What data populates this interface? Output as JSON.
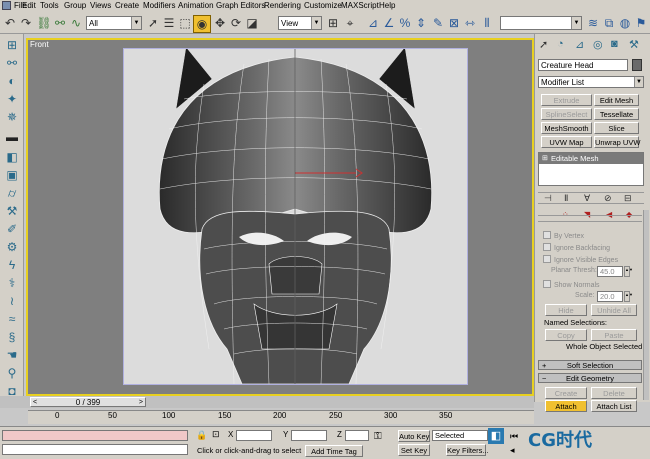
{
  "menu": [
    "File",
    "Edit",
    "Tools",
    "Group",
    "Views",
    "Create",
    "Modifiers",
    "Animation",
    "Graph Editors",
    "Rendering",
    "Customize",
    "MAXScript",
    "Help"
  ],
  "toolbar": {
    "selection_filter": "All",
    "reference_coord": "View",
    "undo_icon": "undo-icon",
    "redo_icon": "redo-icon"
  },
  "viewport": {
    "label": "Front"
  },
  "command_panel": {
    "object_name": "Creature Head",
    "modifier_list": "Modifier List",
    "modifier_buttons": [
      "Extrude",
      "Edit Mesh",
      "SplineSelect",
      "Tessellate",
      "MeshSmooth",
      "Slice",
      "UVW Map",
      "Unwrap UVW"
    ],
    "stack_item": "Editable Mesh",
    "selection": {
      "by_vertex": "By Vertex",
      "ignore_backfacing": "Ignore Backfacing",
      "ignore_visible_edges": "Ignore Visible Edges",
      "planar_thresh_label": "Planar Thresh:",
      "planar_thresh_value": "45.0",
      "show_normals": "Show Normals",
      "scale_label": "Scale:",
      "scale_value": "20.0",
      "hide": "Hide",
      "unhide_all": "Unhide All",
      "named_selections": "Named Selections:",
      "copy": "Copy",
      "paste": "Paste",
      "whole_object": "Whole Object Selected"
    },
    "rollouts": {
      "soft_selection": "Soft Selection",
      "edit_geometry": "Edit Geometry"
    },
    "edit_geometry": {
      "create": "Create",
      "delete": "Delete",
      "attach": "Attach",
      "attach_list": "Attach List"
    }
  },
  "timeline": {
    "frame_display": "0 / 399",
    "ticks": [
      "0",
      "50",
      "100",
      "150",
      "200",
      "250",
      "300",
      "350"
    ]
  },
  "status": {
    "x_label": "X",
    "y_label": "Y",
    "z_label": "Z",
    "prompt": "Click or click-and-drag to select ob",
    "add_time_tag": "Add Time Tag",
    "auto_key": "Auto Key",
    "set_key": "Set Key",
    "key_mode": "Selected",
    "key_filters": "Key Filters...",
    "watermark": "CG时代"
  }
}
